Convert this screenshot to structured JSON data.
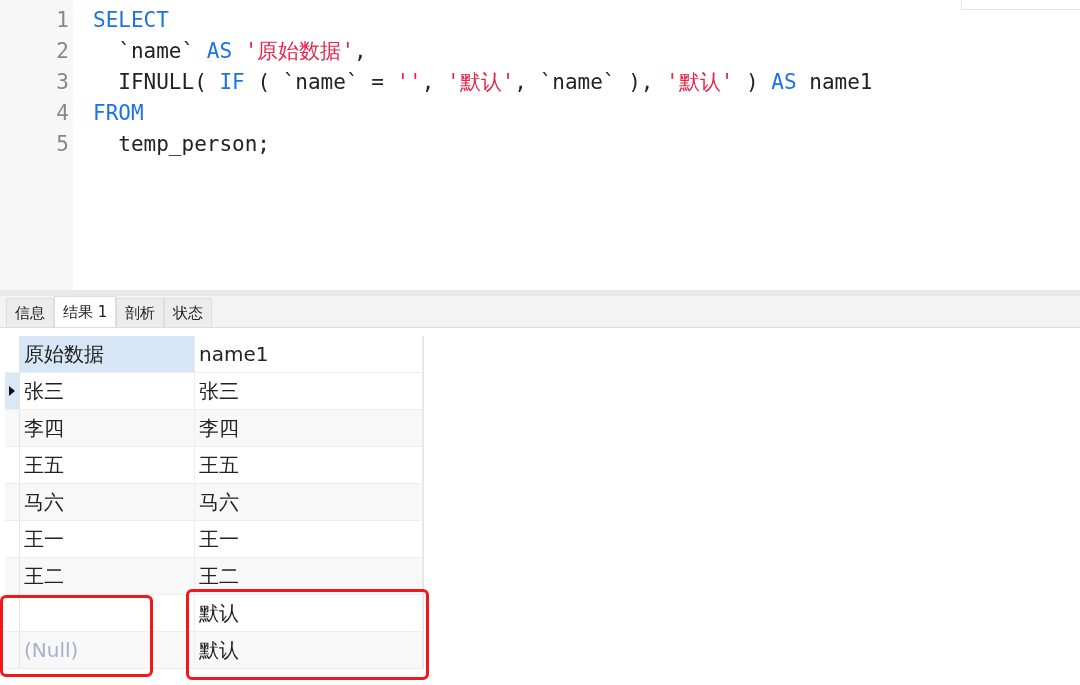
{
  "editor": {
    "lines": [
      {
        "number": "1",
        "tokens": [
          {
            "kind": "keyword",
            "text": "SELECT"
          }
        ]
      },
      {
        "number": "2",
        "tokens": [
          {
            "kind": "plain",
            "text": "  `name` "
          },
          {
            "kind": "keyword",
            "text": "AS"
          },
          {
            "kind": "string",
            "text": " '原始数据'"
          },
          {
            "kind": "plain",
            "text": ","
          }
        ]
      },
      {
        "number": "3",
        "tokens": [
          {
            "kind": "plain",
            "text": "  IFNULL( "
          },
          {
            "kind": "keyword",
            "text": "IF"
          },
          {
            "kind": "plain",
            "text": " ( `name` = "
          },
          {
            "kind": "string",
            "text": "''"
          },
          {
            "kind": "plain",
            "text": ", "
          },
          {
            "kind": "string",
            "text": "'默认'"
          },
          {
            "kind": "plain",
            "text": ", `name` ), "
          },
          {
            "kind": "string",
            "text": "'默认'"
          },
          {
            "kind": "plain",
            "text": " ) "
          },
          {
            "kind": "keyword",
            "text": "AS"
          },
          {
            "kind": "plain",
            "text": " name1"
          }
        ]
      },
      {
        "number": "4",
        "tokens": [
          {
            "kind": "keyword",
            "text": "FROM"
          }
        ]
      },
      {
        "number": "5",
        "tokens": [
          {
            "kind": "plain",
            "text": "  temp_person;"
          }
        ]
      }
    ]
  },
  "tabs": [
    {
      "label": "信息",
      "selected": false
    },
    {
      "label": "结果 1",
      "selected": true
    },
    {
      "label": "剖析",
      "selected": false
    },
    {
      "label": "状态",
      "selected": false
    }
  ],
  "table": {
    "columns": [
      {
        "label": "原始数据",
        "selected": true
      },
      {
        "label": "name1",
        "selected": false
      }
    ],
    "rows": [
      {
        "selected": true,
        "cells": [
          {
            "kind": "value",
            "text": "张三"
          },
          {
            "kind": "value",
            "text": "张三"
          }
        ]
      },
      {
        "selected": false,
        "cells": [
          {
            "kind": "value",
            "text": "李四"
          },
          {
            "kind": "value",
            "text": "李四"
          }
        ]
      },
      {
        "selected": false,
        "cells": [
          {
            "kind": "value",
            "text": "王五"
          },
          {
            "kind": "value",
            "text": "王五"
          }
        ]
      },
      {
        "selected": false,
        "cells": [
          {
            "kind": "value",
            "text": "马六"
          },
          {
            "kind": "value",
            "text": "马六"
          }
        ]
      },
      {
        "selected": false,
        "cells": [
          {
            "kind": "value",
            "text": "王一"
          },
          {
            "kind": "value",
            "text": "王一"
          }
        ]
      },
      {
        "selected": false,
        "cells": [
          {
            "kind": "value",
            "text": "王二"
          },
          {
            "kind": "value",
            "text": "王二"
          }
        ]
      },
      {
        "selected": false,
        "cells": [
          {
            "kind": "empty"
          },
          {
            "kind": "value",
            "text": "默认"
          }
        ]
      },
      {
        "selected": false,
        "cells": [
          {
            "kind": "null",
            "text": "(Null)"
          },
          {
            "kind": "value",
            "text": "默认"
          }
        ]
      }
    ]
  }
}
